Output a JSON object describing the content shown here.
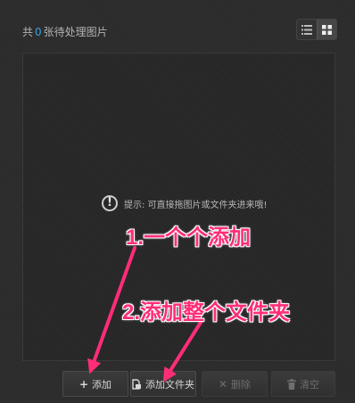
{
  "header": {
    "count_prefix": "共",
    "count_value": "0",
    "count_suffix": "张待处理图片",
    "view_toggle": {
      "list_icon": "list-icon",
      "grid_icon": "grid-icon",
      "active": "grid"
    }
  },
  "drop_area": {
    "hint_icon": "exclamation-icon",
    "hint_text": "提示: 可直接拖图片或文件夹进来哦!"
  },
  "buttons": {
    "add_label": "添加",
    "add_icon": "plus-icon",
    "add_folder_label": "添加文件夹",
    "add_folder_icon": "folder-icon",
    "delete_label": "删除",
    "delete_icon": "x-icon",
    "clear_label": "清空",
    "clear_icon": "trash-icon"
  },
  "annotations": {
    "step1": "1.一个个添加",
    "step2": "2.添加整个文件夹",
    "color": "#ff2d78"
  }
}
